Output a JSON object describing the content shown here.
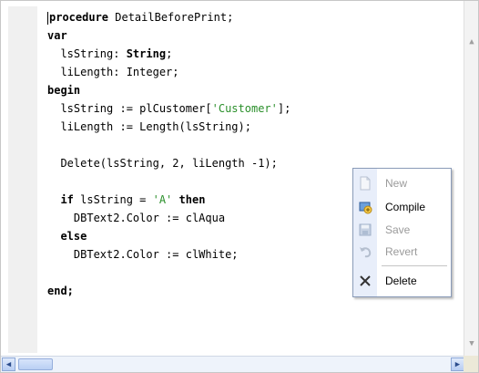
{
  "code": {
    "lines": [
      [
        {
          "t": "procedure",
          "c": "kw"
        },
        {
          "t": " DetailBeforePrint;"
        }
      ],
      [
        {
          "t": "var",
          "c": "kw"
        }
      ],
      [
        {
          "t": "  lsString: "
        },
        {
          "t": "String",
          "c": "kw"
        },
        {
          "t": ";"
        }
      ],
      [
        {
          "t": "  liLength: Integer;"
        }
      ],
      [
        {
          "t": "begin",
          "c": "kw"
        }
      ],
      [
        {
          "t": "  lsString := plCustomer["
        },
        {
          "t": "'Customer'",
          "c": "str"
        },
        {
          "t": "];"
        }
      ],
      [
        {
          "t": "  liLength := Length(lsString);"
        }
      ],
      [
        {
          "t": ""
        }
      ],
      [
        {
          "t": "  Delete(lsString, 2, liLength -1);"
        }
      ],
      [
        {
          "t": ""
        }
      ],
      [
        {
          "t": "  "
        },
        {
          "t": "if",
          "c": "kw"
        },
        {
          "t": " lsString = "
        },
        {
          "t": "'A'",
          "c": "str"
        },
        {
          "t": " "
        },
        {
          "t": "then",
          "c": "kw"
        }
      ],
      [
        {
          "t": "    DBText2.Color := clAqua"
        }
      ],
      [
        {
          "t": "  "
        },
        {
          "t": "else",
          "c": "kw"
        }
      ],
      [
        {
          "t": "    DBText2.Color := clWhite;"
        }
      ],
      [
        {
          "t": ""
        }
      ],
      [
        {
          "t": "end;",
          "c": "kw"
        }
      ]
    ]
  },
  "context_menu": {
    "items": [
      {
        "label": "New",
        "enabled": false,
        "icon": "new-document-icon"
      },
      {
        "label": "Compile",
        "enabled": true,
        "icon": "compile-icon"
      },
      {
        "label": "Save",
        "enabled": false,
        "icon": "save-icon"
      },
      {
        "label": "Revert",
        "enabled": false,
        "icon": "revert-icon"
      },
      {
        "label": "Delete",
        "enabled": true,
        "icon": "delete-icon"
      }
    ]
  },
  "colors": {
    "string_literal": "#2a8f2a",
    "menu_stripe": "#e8eefa",
    "disabled_text": "#9a9a9a"
  }
}
